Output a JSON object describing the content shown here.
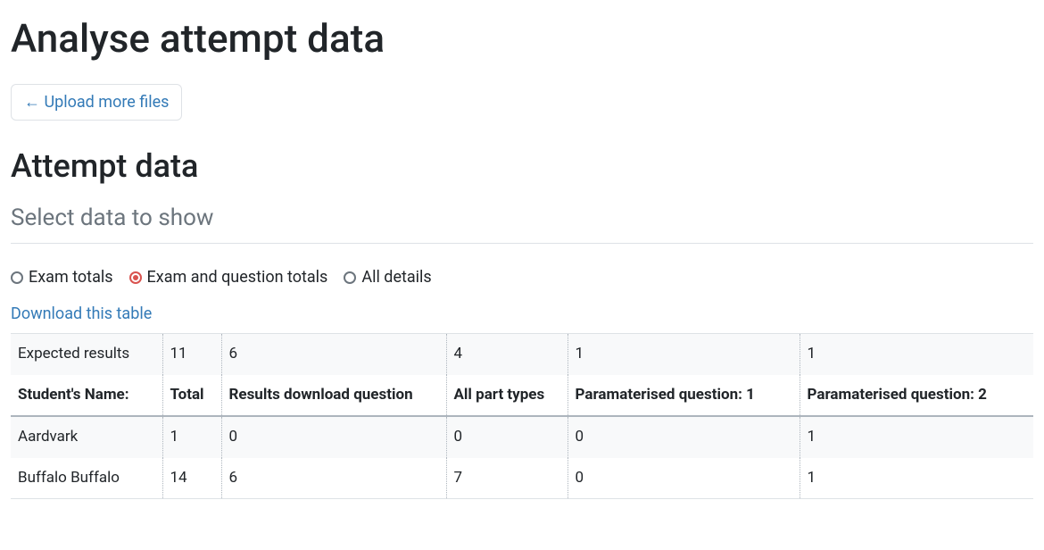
{
  "page": {
    "title": "Analyse attempt data",
    "upload_button": "← Upload more files",
    "section_title": "Attempt data",
    "subsection_title": "Select data to show"
  },
  "view_modes": {
    "exam_totals": "Exam totals",
    "exam_question_totals": "Exam and question totals",
    "all_details": "All details",
    "selected": "exam_question_totals"
  },
  "download_link": "Download this table",
  "table": {
    "expected_label": "Expected results",
    "headers": {
      "name": "Student's Name:",
      "total": "Total",
      "q1": "Results download question",
      "q2": "All part types",
      "q3": "Paramaterised question: 1",
      "q4": "Paramaterised question: 2"
    },
    "expected": {
      "total": "11",
      "q1": "6",
      "q2": "4",
      "q3": "1",
      "q4": "1"
    },
    "rows": [
      {
        "name": "Aardvark",
        "total": "1",
        "q1": "0",
        "q2": "0",
        "q3": "0",
        "q4": "1"
      },
      {
        "name": "Buffalo Buffalo",
        "total": "14",
        "q1": "6",
        "q2": "7",
        "q3": "0",
        "q4": "1"
      }
    ]
  }
}
